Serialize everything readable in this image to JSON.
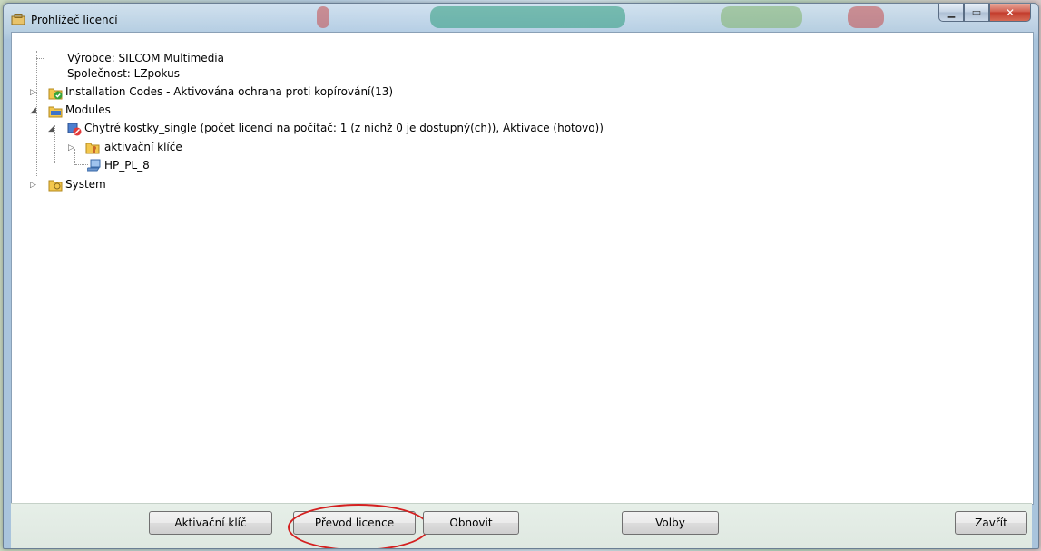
{
  "window": {
    "title": "Prohlížeč licencí"
  },
  "tree": {
    "vendor": "Výrobce: SILCOM Multimedia",
    "company": "Společnost: LZpokus",
    "installation_codes": "Installation Codes - Aktivována ochrana proti kopírování(13)",
    "modules": "Modules",
    "module_item": "Chytré kostky_single (počet licencí na počítač: 1 (z nichž 0 je dostupný(ch)), Aktivace (hotovo))",
    "activation_keys": "aktivační klíče",
    "computer": "HP_PL_8",
    "system": "System"
  },
  "buttons": {
    "activation_key": "Aktivační klíč",
    "transfer_license": "Převod licence",
    "refresh": "Obnovit",
    "options": "Volby",
    "close": "Zavřít"
  },
  "colors": {
    "highlight_ellipse": "#d42020",
    "client_bg": "#ffffff"
  }
}
